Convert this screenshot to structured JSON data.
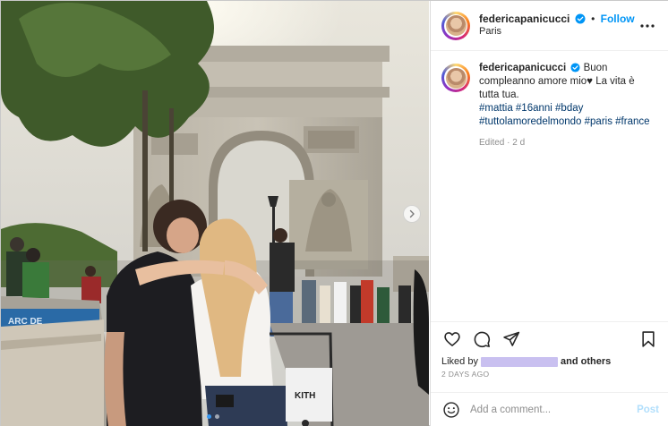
{
  "post": {
    "username": "federicapanicucci",
    "follow_label": "Follow",
    "separator": "•",
    "location": "Paris",
    "more_icon": "more-horizontal-icon"
  },
  "caption": {
    "username": "federicapanicucci",
    "text_line1": "Buon",
    "text_line2": "compleanno amore mio",
    "heart": "♥",
    "text_line3": " La vita è",
    "text_line4": "tutta tua.",
    "hashtags_line1": "#mattia #16anni #bday",
    "hashtags_line2": "#tuttolamoredelmondo #paris #france",
    "edited": "Edited · 2 d"
  },
  "actions": {
    "like_icon": "heart-icon",
    "comment_icon": "comment-icon",
    "share_icon": "send-icon",
    "save_icon": "bookmark-icon"
  },
  "likes": {
    "prefix": "Liked by",
    "suffix": "and others"
  },
  "timestamp": "2 DAYS AGO",
  "comment": {
    "placeholder": "Add a comment...",
    "post_label": "Post",
    "emoji_icon": "emoji-icon"
  },
  "photo": {
    "sign_text": "ARC DE",
    "bag_text": "KITH",
    "next_icon": "chevron-right-icon",
    "carousel": {
      "count": 2,
      "active_index": 1
    }
  },
  "colors": {
    "accent": "#0095f6",
    "hashtag": "#00376b",
    "muted": "#8e8e8e",
    "post_disabled": "#b2dffc",
    "carousel_active": "#3797f0"
  }
}
